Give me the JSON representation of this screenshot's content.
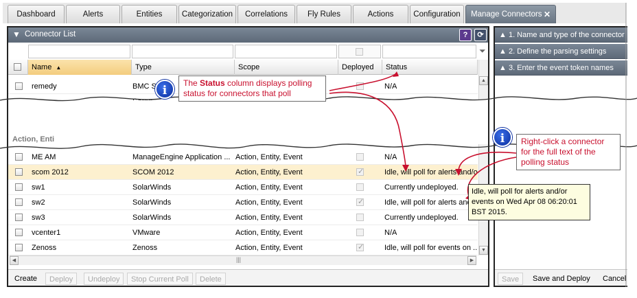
{
  "tabs": [
    {
      "label": "Dashboard"
    },
    {
      "label": "Alerts"
    },
    {
      "label": "Entities"
    },
    {
      "label": "Categorization"
    },
    {
      "label": "Correlations"
    },
    {
      "label": "Fly Rules"
    },
    {
      "label": "Actions"
    },
    {
      "label": "Configuration"
    },
    {
      "label": "Manage Connectors",
      "active": true
    }
  ],
  "connector_list": {
    "title": "Connector List",
    "help_icon": "help-icon",
    "refresh_icon": "refresh-icon",
    "filter_icon": "funnel-filter-icon",
    "columns": {
      "name": "Name",
      "type": "Type",
      "scope": "Scope",
      "deployed": "Deployed",
      "status": "Status"
    },
    "top_rows": [
      {
        "name": "remedy",
        "type": "BMC Se",
        "scope": "",
        "status": "N/A"
      },
      {
        "name": "",
        "type": "Seren",
        "scope": "",
        "status": ""
      }
    ],
    "group_label": "Action, Enti",
    "rows": [
      {
        "name": "ME AM",
        "type": "ManageEngine Application ...",
        "scope": "Action, Entity, Event",
        "deployed": false,
        "status": "N/A"
      },
      {
        "name": "scom 2012",
        "type": "SCOM 2012",
        "scope": "Action, Entity, Event",
        "deployed": true,
        "status": "Idle, will poll for alerts and/o..."
      },
      {
        "name": "sw1",
        "type": "SolarWinds",
        "scope": "Action, Entity, Event",
        "deployed": false,
        "status": "Currently undeployed."
      },
      {
        "name": "sw2",
        "type": "SolarWinds",
        "scope": "Action, Entity, Event",
        "deployed": true,
        "status": "Idle, will poll for alerts and"
      },
      {
        "name": "sw3",
        "type": "SolarWinds",
        "scope": "Action, Entity, Event",
        "deployed": false,
        "status": "Currently undeployed."
      },
      {
        "name": "vcenter1",
        "type": "VMware",
        "scope": "Action, Entity, Event",
        "deployed": false,
        "status": "N/A"
      },
      {
        "name": "Zenoss",
        "type": "Zenoss",
        "scope": "Action, Entity, Event",
        "deployed": true,
        "status": "Idle, will poll for events on ..."
      }
    ],
    "actions": {
      "create": "Create",
      "deploy": "Deploy",
      "undeploy": "Undeploy",
      "stop_poll": "Stop Current Poll",
      "delete": "Delete"
    }
  },
  "wizard": {
    "steps": [
      "1. Name and type of the connector",
      "2. Define the parsing settings",
      "3. Enter the event token names"
    ],
    "save": "Save",
    "save_deploy": "Save and Deploy",
    "cancel": "Cancel"
  },
  "annotations": {
    "status_callout_pre": "The ",
    "status_callout_bold": "Status",
    "status_callout_post": " column displays polling status for connectors that poll",
    "rightclick_callout": "Right-click a connector for the full text of the polling status",
    "tooltip": "Idle, will poll for alerts and/or events on Wed Apr 08 06:20:01 BST 2015.",
    "info_glyph": "i",
    "callout_color": "#c8102e"
  }
}
